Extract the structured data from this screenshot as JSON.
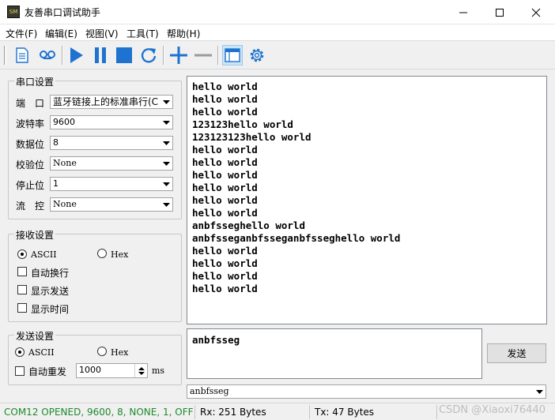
{
  "window": {
    "title": "友善串口调试助手",
    "icon_text": "SM",
    "controls": [
      "minimize-icon",
      "maximize-icon",
      "close-icon"
    ]
  },
  "menu": [
    "文件(F)",
    "编辑(E)",
    "视图(V)",
    "工具(T)",
    "帮助(H)"
  ],
  "toolbar": {
    "icons": [
      "document-icon",
      "record-icon",
      "play-icon",
      "pause-icon",
      "stop-icon",
      "refresh-icon",
      "plus-icon",
      "minus-icon",
      "window-icon",
      "gear-icon"
    ],
    "accent": "#1e73d0"
  },
  "serial_settings": {
    "title": "串口设置",
    "port_label": "端　口",
    "port_value": "蓝牙链接上的标准串行(C",
    "baud_label": "波特率",
    "baud_value": "9600",
    "databits_label": "数据位",
    "databits_value": "8",
    "parity_label": "校验位",
    "parity_value": "None",
    "stopbits_label": "停止位",
    "stopbits_value": "1",
    "flow_label": "流　控",
    "flow_value": "None"
  },
  "receive_settings": {
    "title": "接收设置",
    "ascii_label": "ASCII",
    "hex_label": "Hex",
    "auto_newline": "自动换行",
    "show_send": "显示发送",
    "show_time": "显示时间",
    "selected": "ASCII"
  },
  "send_settings": {
    "title": "发送设置",
    "ascii_label": "ASCII",
    "hex_label": "Hex",
    "auto_resend": "自动重发",
    "interval_value": "1000",
    "unit": "ms",
    "selected": "ASCII"
  },
  "receive_lines": [
    "hello world",
    "hello world",
    "hello world",
    "123123hello world",
    "123123123hello world",
    "hello world",
    "hello world",
    "hello world",
    "hello world",
    "hello world",
    "hello world",
    "anbfsseghello world",
    "anbfsseganbfsseganbfsseghello world",
    "hello world",
    "hello world",
    "hello world",
    "hello world"
  ],
  "send_text": "anbfsseg",
  "send_button": "发送",
  "history_value": "anbfsseg",
  "status": {
    "connection": "COM12 OPENED, 9600, 8, NONE, 1, OFF",
    "rx": "Rx: 251 Bytes",
    "tx": "Tx: 47 Bytes",
    "watermark": "CSDN @Xiaoxi76440",
    "open_color": "#1b8a2b"
  }
}
